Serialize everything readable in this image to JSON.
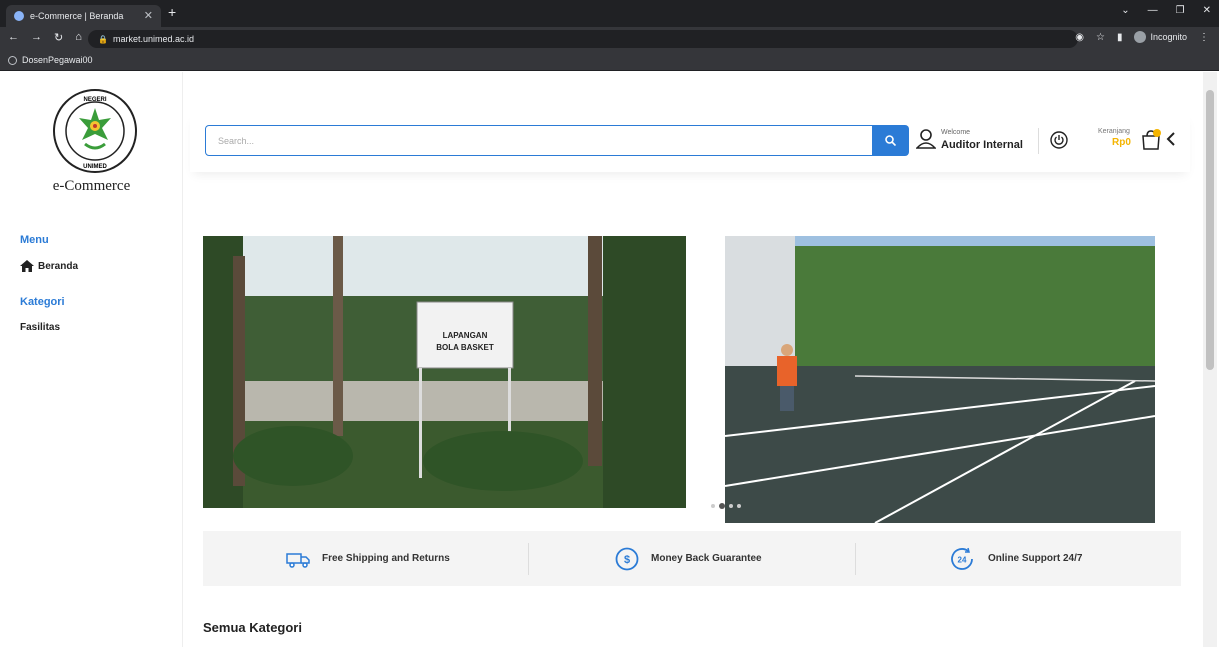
{
  "browser": {
    "tab_title": "e-Commerce | Beranda",
    "url": "market.unimed.ac.id",
    "incognito_label": "Incognito",
    "bookmark": "DosenPegawai00"
  },
  "sidebar": {
    "logo_text": "e-Commerce",
    "menu_heading": "Menu",
    "menu_item": "Beranda",
    "category_heading": "Kategori",
    "category_item": "Fasilitas"
  },
  "header": {
    "search_placeholder": "Search...",
    "welcome": "Welcome",
    "username": "Auditor Internal",
    "cart_label": "Keranjang",
    "cart_value": "Rp0"
  },
  "features": [
    {
      "label": "Free Shipping and Returns",
      "icon": "truck-icon"
    },
    {
      "label": "Money Back Guarantee",
      "icon": "dollar-circle-icon"
    },
    {
      "label": "Online Support 24/7",
      "icon": "support-24-icon"
    }
  ],
  "banner": {
    "sign_title": "LAPANGAN",
    "sign_subtitle": "BOLA BASKET"
  },
  "section": {
    "title": "Semua Kategori"
  },
  "colors": {
    "accent": "#2b7bd6",
    "cart_value": "#f4b400"
  }
}
